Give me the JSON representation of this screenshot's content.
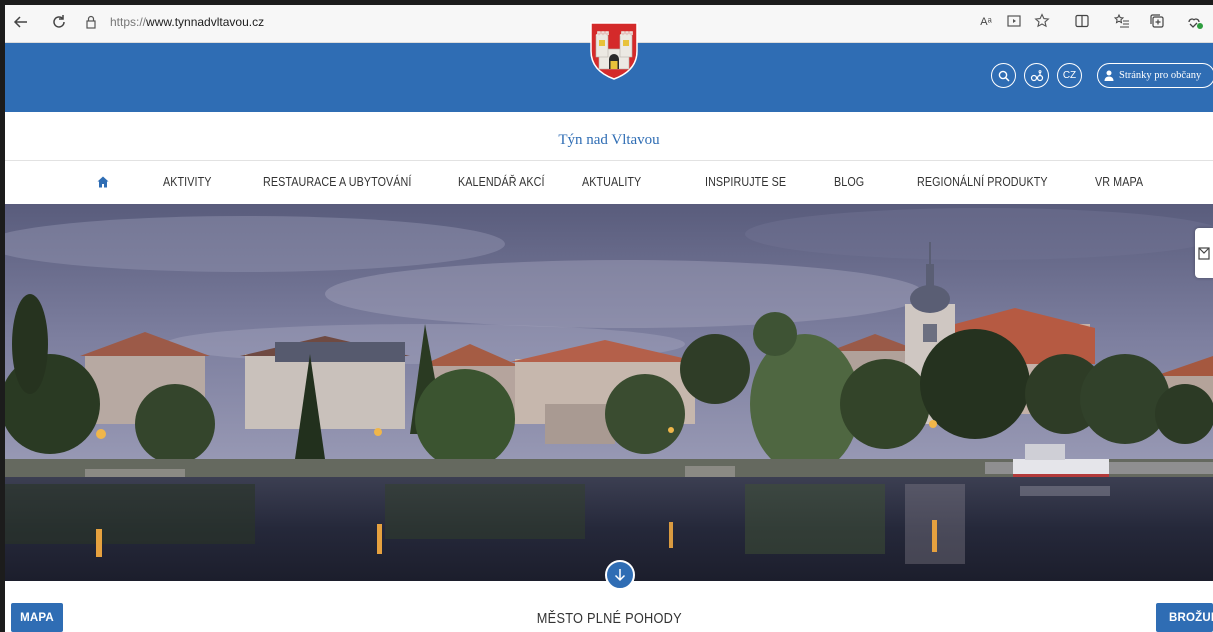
{
  "browser": {
    "url_scheme": "https://",
    "url_host": "www.tynnadvltavou.cz",
    "read_aloud_label": "Aᵃ"
  },
  "header": {
    "language": "CZ",
    "citizens_button": "Stránky pro občany",
    "brand_name": "Týn nad Vltavou"
  },
  "nav": {
    "items": [
      {
        "label": "AKTIVITY"
      },
      {
        "label": "RESTAURACE A UBYTOVÁNÍ"
      },
      {
        "label": "KALENDÁŘ AKCÍ"
      },
      {
        "label": "AKTUALITY"
      },
      {
        "label": "INSPIRUJTE SE"
      },
      {
        "label": "BLOG"
      },
      {
        "label": "REGIONÁLNÍ PRODUKTY"
      },
      {
        "label": "VR MAPA"
      }
    ]
  },
  "bottom": {
    "map_button": "MAPA",
    "slogan": "MĚSTO PLNÉ POHODY",
    "brochure_button": "BROŽURA"
  },
  "colors": {
    "brand_blue": "#2f6db4",
    "crest_red": "#d42a2a",
    "crest_gold": "#e8c23a"
  }
}
